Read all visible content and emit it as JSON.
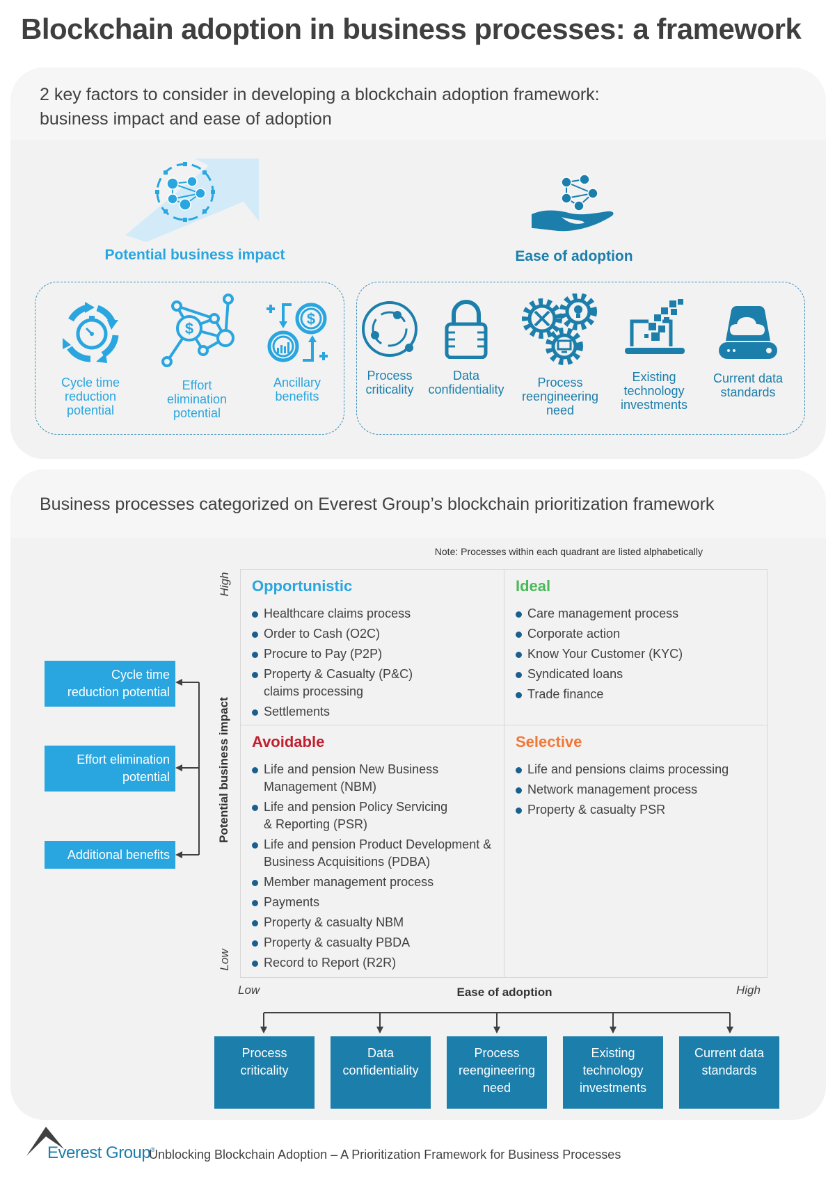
{
  "title": "Blockchain adoption in business processes: a framework",
  "section1": {
    "heading_line1": "2 key factors to consider in developing a blockchain adoption framework:",
    "heading_line2": "business impact and ease of adoption",
    "impact": {
      "title": "Potential business impact",
      "items": [
        {
          "icon": "stopwatch-cycle-icon",
          "line1": "Cycle time",
          "line2": "reduction",
          "line3": "potential"
        },
        {
          "icon": "network-dollar-icon",
          "line1": "Effort",
          "line2": "elimination",
          "line3": "potential"
        },
        {
          "icon": "coins-benefit-icon",
          "line1": "Ancillary",
          "line2": "benefits",
          "line3": ""
        }
      ]
    },
    "ease": {
      "title": "Ease of adoption",
      "items": [
        {
          "icon": "orbit-icon",
          "line1": "Process",
          "line2": "criticality",
          "line3": ""
        },
        {
          "icon": "padlock-icon",
          "line1": "Data",
          "line2": "confidentiality",
          "line3": ""
        },
        {
          "icon": "gears-icon",
          "line1": "Process",
          "line2": "reengineering",
          "line3": "need"
        },
        {
          "icon": "laptop-pixels-icon",
          "line1": "Existing",
          "line2": "technology",
          "line3": "investments"
        },
        {
          "icon": "cloud-drive-icon",
          "line1": "Current data",
          "line2": "standards",
          "line3": ""
        }
      ]
    }
  },
  "section2": {
    "heading": "Business processes categorized on Everest Group’s blockchain prioritization framework",
    "note": "Note: Processes within each quadrant are listed alphabetically",
    "y_axis": {
      "label": "Potential business impact",
      "high": "High",
      "low": "Low"
    },
    "x_axis": {
      "label": "Ease of adoption",
      "low": "Low",
      "high": "High"
    },
    "quadrants": {
      "opportunistic": {
        "title": "Opportunistic",
        "color": "#29a5df",
        "items": [
          "Healthcare claims process",
          "Order to Cash (O2C)",
          "Procure to Pay (P2P)",
          "Property & Casualty (P&C) claims processing",
          "Settlements"
        ]
      },
      "ideal": {
        "title": "Ideal",
        "color": "#4cb85c",
        "items": [
          "Care management process",
          "Corporate action",
          "Know Your Customer (KYC)",
          "Syndicated loans",
          "Trade finance"
        ]
      },
      "avoidable": {
        "title": "Avoidable",
        "color": "#c0202f",
        "items": [
          "Life and pension New Business Management (NBM)",
          "Life and pension Policy Servicing & Reporting (PSR)",
          "Life and pension Product Development & Business Acquisitions (PDBA)",
          "Member management process",
          "Payments",
          "Property & casualty NBM",
          "Property & casualty PBDA",
          "Record to Report (R2R)"
        ]
      },
      "selective": {
        "title": "Selective",
        "color": "#f07836",
        "items": [
          "Life and pensions claims processing",
          "Network management process",
          "Property & casualty PSR"
        ]
      }
    },
    "impact_boxes": [
      {
        "line1": "Cycle time",
        "line2": "reduction potential"
      },
      {
        "line1": "Effort elimination",
        "line2": "potential"
      },
      {
        "line1": "Additional benefits",
        "line2": ""
      }
    ],
    "ease_boxes": [
      {
        "line1": "Process",
        "line2": "criticality",
        "line3": ""
      },
      {
        "line1": "Data",
        "line2": "confidentiality",
        "line3": ""
      },
      {
        "line1": "Process",
        "line2": "reengineering",
        "line3": "need"
      },
      {
        "line1": "Existing",
        "line2": "technology",
        "line3": "investments"
      },
      {
        "line1": "Current data",
        "line2": "standards",
        "line3": ""
      }
    ]
  },
  "footer": {
    "brand": "Everest Group",
    "registered": "®",
    "subtitle": "Unblocking Blockchain Adoption – A Prioritization Framework for Business Processes"
  },
  "colors": {
    "light_blue": "#29a5df",
    "dark_blue": "#1b7eab",
    "panel_bg": "#f2f2f2"
  }
}
